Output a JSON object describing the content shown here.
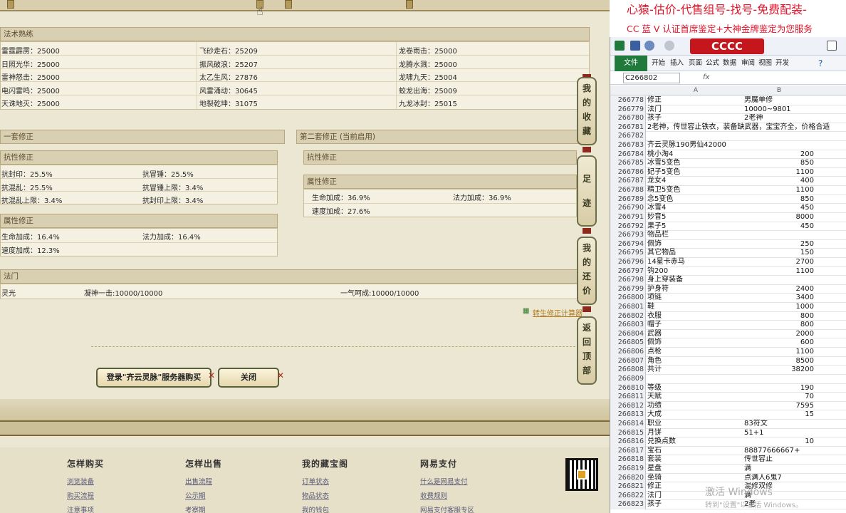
{
  "skills": {
    "title": "法术熟练",
    "rows": [
      [
        "雷霆霹雳：25000",
        "飞砂走石：25209",
        "龙卷雨击：25000"
      ],
      [
        "日照光华：25000",
        "振风破浪：25207",
        "龙腾水溅：25000"
      ],
      [
        "雷神怒击：25000",
        "太乙生风：27876",
        "龙啸九天：25004"
      ],
      [
        "电闪雷鸣：25000",
        "风雷涌动：30645",
        "蛟龙出海：25009"
      ],
      [
        "天诛地灭：25000",
        "地裂乾坤：31075",
        "九龙冰封：25015"
      ]
    ]
  },
  "set1": {
    "title": "一套修正",
    "resist_title": "抗性修正",
    "resist": [
      [
        "抗封印：25.5%",
        "抗冒锤：25.5%"
      ],
      [
        "抗混乱：25.5%",
        "抗冒锤上限：3.4%"
      ],
      [
        "抗混乱上限：3.4%",
        "抗封印上限：3.4%"
      ]
    ],
    "attr_title": "属性修正",
    "attr": [
      [
        "生命加成：16.4%",
        "法力加成：16.4%"
      ],
      [
        "速度加成：12.3%",
        ""
      ]
    ]
  },
  "set2": {
    "title": "第二套修正 (当前启用)",
    "resist_title": "抗性修正",
    "attr_title": "属性修正",
    "attr": [
      [
        "生命加成：36.9%",
        "法力加成：36.9%"
      ],
      [
        "速度加成：27.6%",
        ""
      ]
    ]
  },
  "fa_men": {
    "title": "法门",
    "cols": [
      "灵光",
      "凝神一击:10000/10000",
      "一气呵成:10000/10000"
    ]
  },
  "calc_link": "转生修正计算器",
  "side_tabs": [
    [
      "我",
      "的",
      "收",
      "藏"
    ],
    [
      "足",
      "迹"
    ],
    [
      "我",
      "的",
      "还",
      "价"
    ],
    [
      "返",
      "回",
      "顶",
      "部"
    ]
  ],
  "buttons": {
    "login": "登录\"齐云灵脉\"服务器购买",
    "close": "关闭",
    "x": "✕"
  },
  "footer": {
    "cols": [
      {
        "title": "怎样购买",
        "links": [
          "浏览装备",
          "购买流程",
          "注意事项"
        ]
      },
      {
        "title": "怎样出售",
        "links": [
          "出售流程",
          "公示期",
          "考察期"
        ]
      },
      {
        "title": "我的藏宝阁",
        "links": [
          "订单状态",
          "物品状态",
          "我的钱包"
        ]
      },
      {
        "title": "网易支付",
        "links": [
          "什么是网易支付",
          "收费规则",
          "网易支付客服专区"
        ]
      }
    ]
  },
  "banner": {
    "line1": "心猿-估价-代售组号-找号-免费配装-",
    "line2": "CC 蓝 V 认证首席鉴定+大神金牌鉴定为您服务",
    "cc_logo": "CCCC"
  },
  "excel": {
    "ribbon_tabs": [
      "开始",
      "插入",
      "页面",
      "公式",
      "数据",
      "审阅",
      "视图",
      "开发"
    ],
    "file_tab": "文件",
    "name_box": "C266802",
    "fx": "fx",
    "col_a": "A",
    "col_b": "B",
    "rows": [
      [
        "266778",
        "修正",
        "男魔单修",
        "t"
      ],
      [
        "266779",
        "法门",
        "10000~9801",
        "t"
      ],
      [
        "266780",
        "孩子",
        "2老神",
        "t"
      ],
      [
        "266781",
        "2老神，传世容止铁衣，装备缺武器，宝宝齐全，价格合适",
        "",
        "t"
      ],
      [
        "266782",
        "",
        "",
        "t"
      ],
      [
        "266783",
        "齐云灵脉190男仙42000",
        "",
        "t"
      ],
      [
        "266784",
        "桃小淘4",
        "200",
        "n"
      ],
      [
        "266785",
        "冰雪5变色",
        "850",
        "n"
      ],
      [
        "266786",
        "妃子5变色",
        "1100",
        "n"
      ],
      [
        "266787",
        "龙女4",
        "400",
        "n"
      ],
      [
        "266788",
        "精卫5变色",
        "1100",
        "n"
      ],
      [
        "266789",
        "念5变色",
        "850",
        "n"
      ],
      [
        "266790",
        "冰雪4",
        "450",
        "n"
      ],
      [
        "266791",
        "妙音5",
        "8000",
        "n"
      ],
      [
        "266792",
        "果子5",
        "450",
        "n"
      ],
      [
        "266793",
        "物品栏",
        "",
        "t"
      ],
      [
        "266794",
        "佩饰",
        "250",
        "n"
      ],
      [
        "266795",
        "其它物品",
        "150",
        "n"
      ],
      [
        "266796",
        "14星卡赤马",
        "2700",
        "n"
      ],
      [
        "266797",
        "钩200",
        "1100",
        "n"
      ],
      [
        "266798",
        "身上穿装备",
        "",
        "t"
      ],
      [
        "266799",
        "护身符",
        "2400",
        "n"
      ],
      [
        "266800",
        "项链",
        "3400",
        "n"
      ],
      [
        "266801",
        "鞋",
        "1000",
        "n"
      ],
      [
        "266802",
        "衣服",
        "800",
        "n"
      ],
      [
        "266803",
        "帽子",
        "800",
        "n"
      ],
      [
        "266804",
        "武器",
        "2000",
        "n"
      ],
      [
        "266805",
        "佩饰",
        "600",
        "n"
      ],
      [
        "266806",
        "点枪",
        "1100",
        "n"
      ],
      [
        "266807",
        "角色",
        "8500",
        "n"
      ],
      [
        "266808",
        "共计",
        "38200",
        "n"
      ],
      [
        "266809",
        "",
        "",
        "t"
      ],
      [
        "266810",
        "等级",
        "190",
        "n"
      ],
      [
        "266811",
        "天赋",
        "70",
        "n"
      ],
      [
        "266812",
        "功绩",
        "7595",
        "n"
      ],
      [
        "266813",
        "大成",
        "15",
        "n"
      ],
      [
        "266814",
        "职业",
        "83符文",
        "t"
      ],
      [
        "266815",
        "月饼",
        "51+1",
        "t"
      ],
      [
        "266816",
        "兑换点数",
        "10",
        "n"
      ],
      [
        "266817",
        "宝石",
        "88877666667+",
        "t"
      ],
      [
        "266818",
        "套装",
        "传世容止",
        "t"
      ],
      [
        "266819",
        "星盘",
        "满",
        "t"
      ],
      [
        "266820",
        "坐骑",
        "点满人6鬼7",
        "t"
      ],
      [
        "266821",
        "修正",
        "混修双修",
        "t"
      ],
      [
        "266822",
        "法门",
        "满",
        "t"
      ],
      [
        "266823",
        "孩子",
        "2老",
        "t"
      ]
    ]
  },
  "watermark": {
    "line1": "激活 Windows",
    "line2": "转到\"设置\"以激活 Windows。"
  }
}
